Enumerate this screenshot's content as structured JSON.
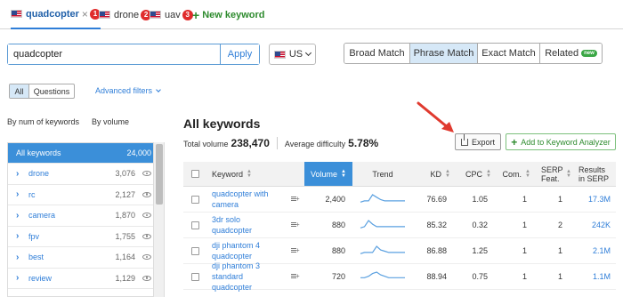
{
  "tabs": [
    {
      "label": "quadcopter",
      "close": "×",
      "badge": "1"
    },
    {
      "label": "drone",
      "badge": "2"
    },
    {
      "label": "uav",
      "badge": "3"
    }
  ],
  "new_keyword": "New keyword",
  "search": {
    "value": "quadcopter",
    "apply": "Apply"
  },
  "country": "US",
  "match_buttons": [
    "Broad Match",
    "Phrase Match",
    "Exact Match",
    "Related"
  ],
  "related_badge": "new",
  "filter_buttons": [
    "All",
    "Questions"
  ],
  "advanced_filters": "Advanced filters",
  "side_tabs": [
    "By num of keywords",
    "By volume"
  ],
  "side_list": {
    "head": {
      "label": "All keywords",
      "count": "24,000"
    },
    "items": [
      {
        "label": "drone",
        "count": "3,076"
      },
      {
        "label": "rc",
        "count": "2,127"
      },
      {
        "label": "camera",
        "count": "1,870"
      },
      {
        "label": "fpv",
        "count": "1,755"
      },
      {
        "label": "best",
        "count": "1,164"
      },
      {
        "label": "review",
        "count": "1,129"
      }
    ]
  },
  "main": {
    "title": "All keywords",
    "total_volume_label": "Total volume",
    "total_volume": "238,470",
    "avg_difficulty_label": "Average difficulty",
    "avg_difficulty": "5.78%",
    "export": "Export",
    "add_to_analyzer": "Add to Keyword Analyzer"
  },
  "table": {
    "headers": [
      "Keyword",
      "Volume",
      "Trend",
      "KD",
      "CPC",
      "Com.",
      "SERP Feat.",
      "Results in SERP"
    ],
    "rows": [
      {
        "kw1": "quadcopter with",
        "kw2": "camera",
        "volume": "2,400",
        "kd": "76.69",
        "cpc": "1.05",
        "com": "1",
        "serp": "1",
        "results": "17.3M",
        "trend": [
          2,
          3,
          3,
          8,
          6,
          4,
          3,
          3,
          3,
          3,
          3,
          3
        ]
      },
      {
        "kw1": "3dr solo",
        "kw2": "quadcopter",
        "volume": "880",
        "kd": "85.32",
        "cpc": "0.32",
        "com": "1",
        "serp": "2",
        "results": "242K",
        "trend": [
          2,
          3,
          8,
          5,
          3,
          3,
          3,
          3,
          3,
          3,
          3,
          3
        ]
      },
      {
        "kw1": "dji phantom 4",
        "kw2": "quadcopter",
        "volume": "880",
        "kd": "86.88",
        "cpc": "1.25",
        "com": "1",
        "serp": "1",
        "results": "2.1M",
        "trend": [
          2,
          3,
          3,
          3,
          8,
          5,
          4,
          3,
          3,
          3,
          3,
          3
        ]
      },
      {
        "kw1": "dji phantom 3",
        "kw2": "standard",
        "kw3": "quadcopter",
        "volume": "720",
        "kd": "88.94",
        "cpc": "0.75",
        "com": "1",
        "serp": "1",
        "results": "1.1M",
        "trend": [
          3,
          3,
          4,
          6,
          7,
          5,
          4,
          3,
          3,
          3,
          3,
          3
        ]
      }
    ]
  },
  "colors": {
    "accent": "#2f7ed8",
    "sorted_header": "#3b8fd9",
    "green": "#2e8b2e",
    "badge_red": "#e02b2b",
    "annotation_arrow": "#e03a2f"
  }
}
